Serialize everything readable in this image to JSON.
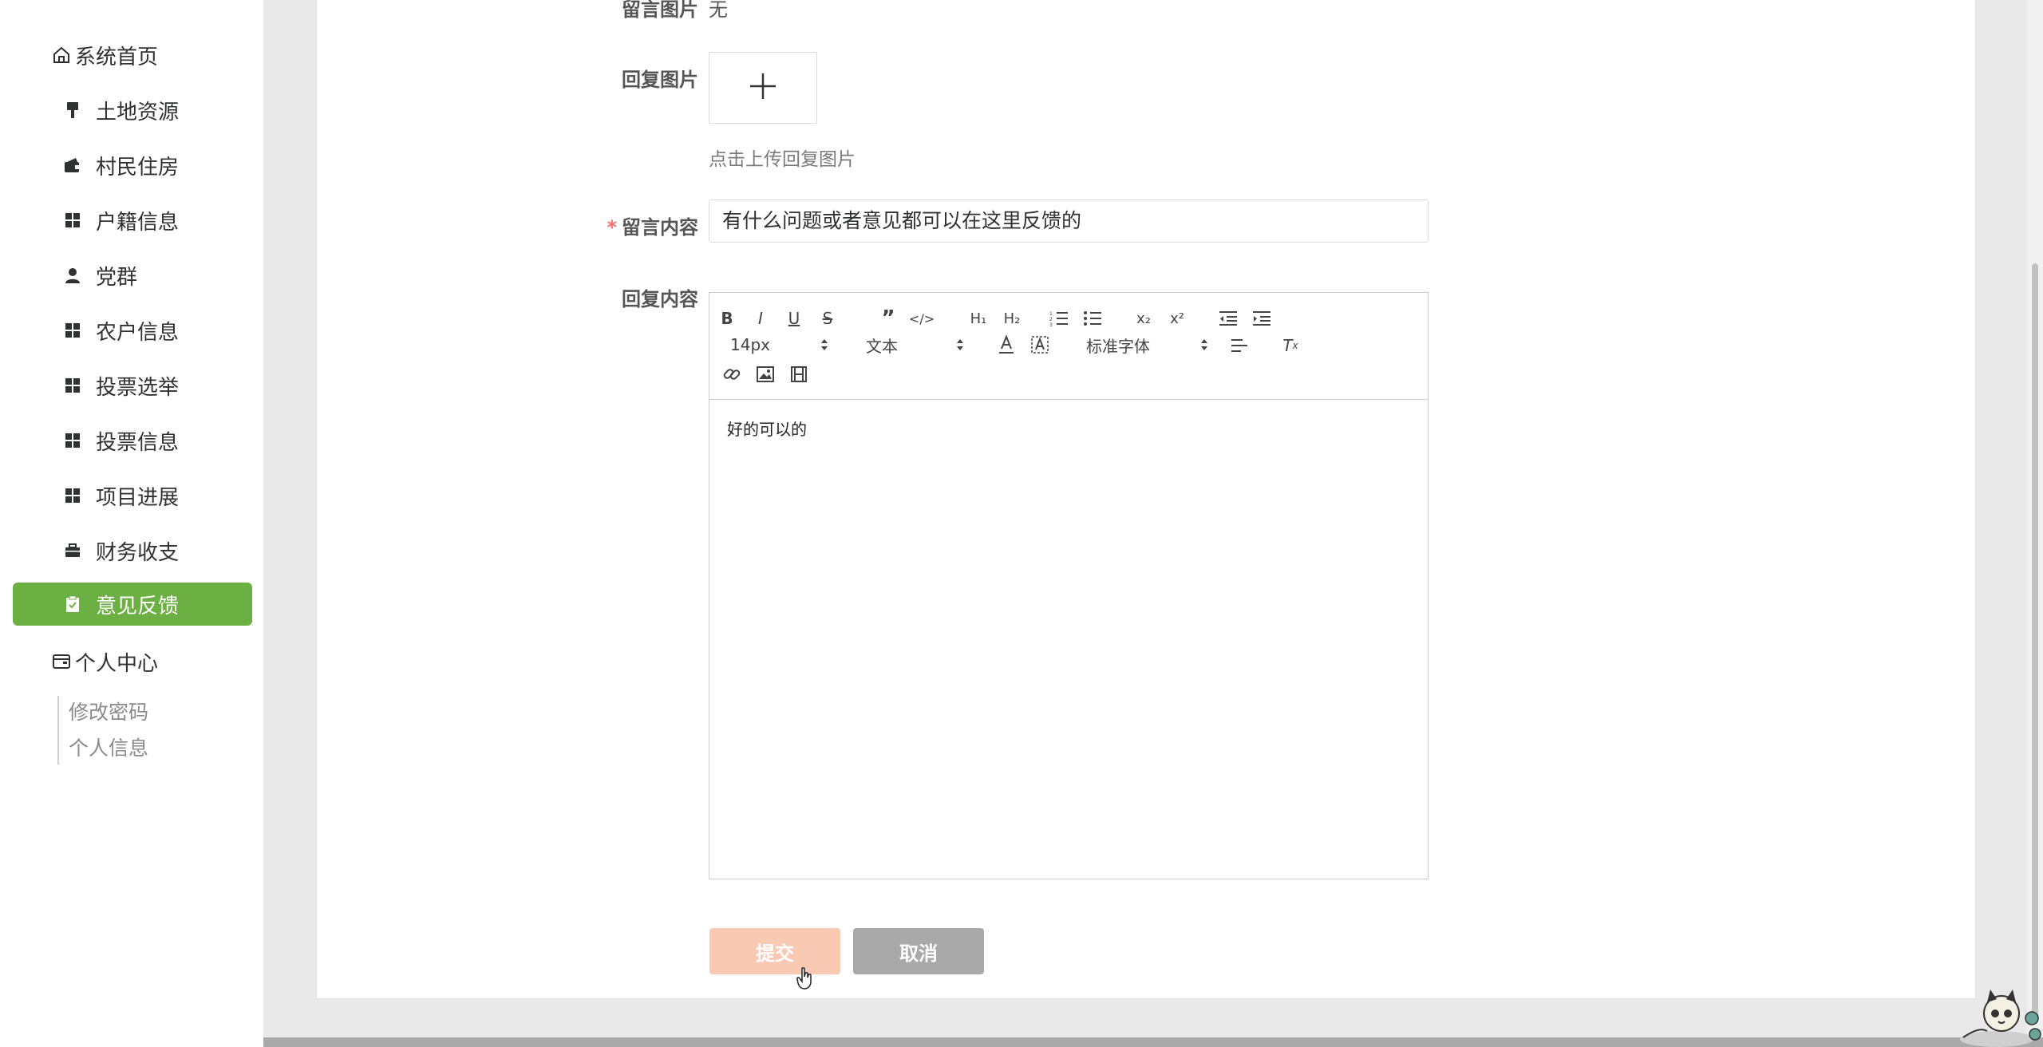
{
  "sidebar": {
    "home": "系统首页",
    "items": [
      {
        "label": "土地资源",
        "icon": "brush-icon"
      },
      {
        "label": "村民住房",
        "icon": "wallet-icon"
      },
      {
        "label": "户籍信息",
        "icon": "grid-icon"
      },
      {
        "label": "党群",
        "icon": "user-icon"
      },
      {
        "label": "农户信息",
        "icon": "grid-icon"
      },
      {
        "label": "投票选举",
        "icon": "grid-icon"
      },
      {
        "label": "投票信息",
        "icon": "grid-icon"
      },
      {
        "label": "项目进展",
        "icon": "grid-icon"
      },
      {
        "label": "财务收支",
        "icon": "briefcase-icon"
      },
      {
        "label": "意见反馈",
        "icon": "clipboard-icon"
      }
    ],
    "active": "意见反馈",
    "personal": "个人中心",
    "sub_items": [
      "修改密码",
      "个人信息"
    ],
    "active_color": "#6cb044"
  },
  "form": {
    "msg_image_label": "留言图片",
    "msg_image_value": "无",
    "reply_image_label": "回复图片",
    "upload_hint": "点击上传回复图片",
    "msg_content_label": "留言内容",
    "msg_content_value": "有什么问题或者意见都可以在这里反馈的",
    "reply_content_label": "回复内容",
    "editor": {
      "size": "14px",
      "header": "文本",
      "font": "标准字体",
      "content": "好的可以的"
    },
    "submit_label": "提交",
    "cancel_label": "取消"
  }
}
